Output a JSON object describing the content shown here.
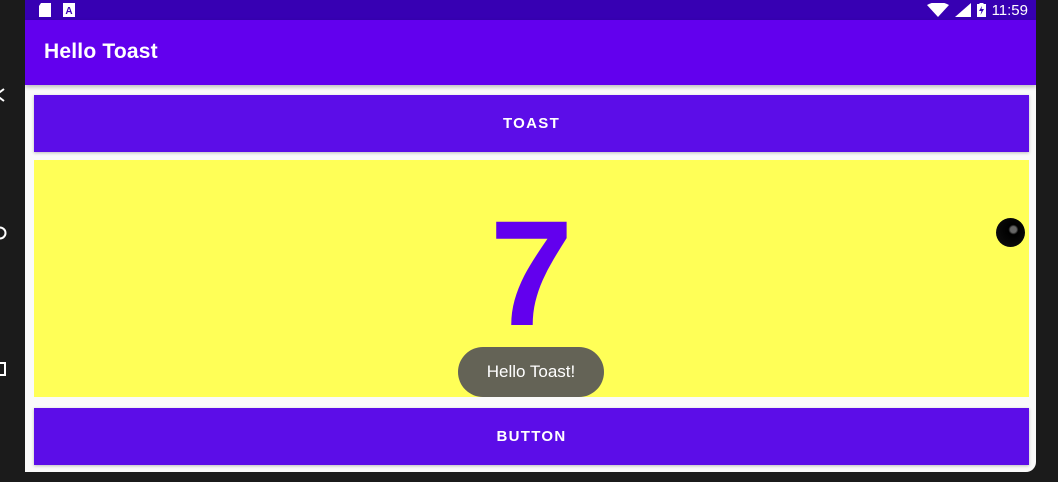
{
  "status_bar": {
    "time": "11:59",
    "left_icons": [
      "sd-card-icon",
      "keyboard-a-icon"
    ],
    "right_icons": [
      "wifi-icon",
      "signal-icon",
      "battery-charging-icon"
    ]
  },
  "app_bar": {
    "title": "Hello Toast"
  },
  "buttons": {
    "toast_label": "TOAST",
    "count_label": "BUTTON"
  },
  "count": {
    "value": "7"
  },
  "toast": {
    "message": "Hello Toast!"
  },
  "colors": {
    "primary": "#6200ee",
    "primary_dark": "#3700b3",
    "count_background": "#ffff57",
    "toast_background": "#646356"
  }
}
